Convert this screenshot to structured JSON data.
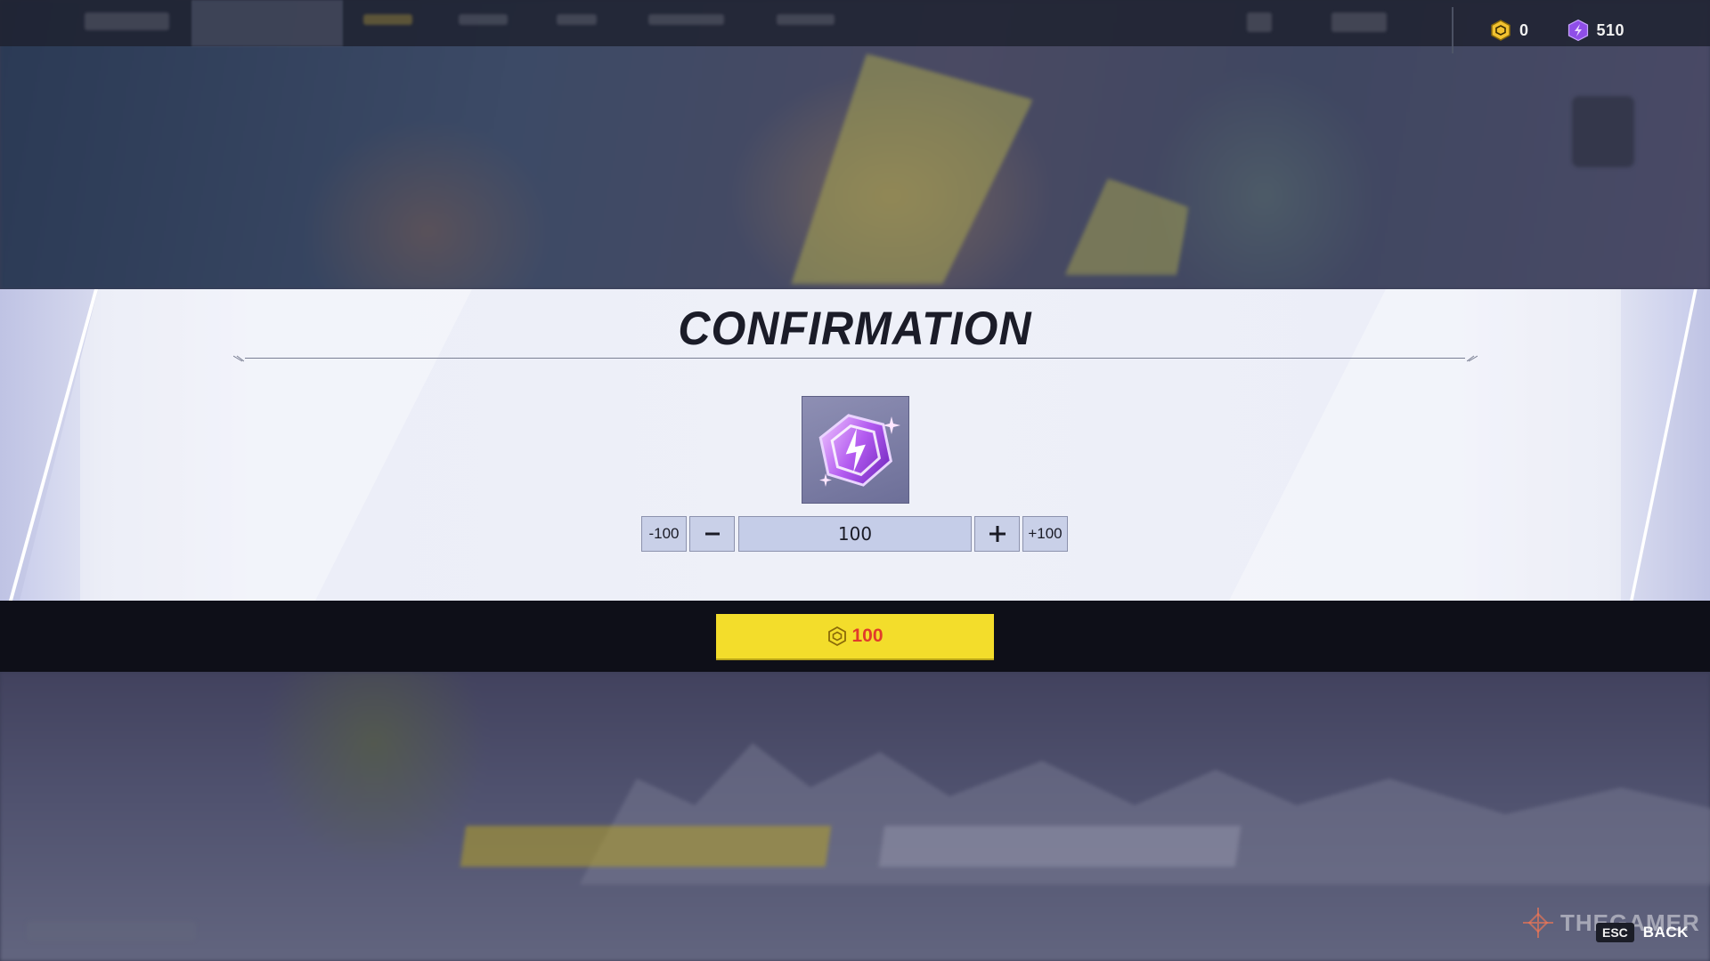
{
  "currency": {
    "gold": {
      "icon": "gold-lattice-icon",
      "amount": "0",
      "color": "#f2c230"
    },
    "units": {
      "icon": "purple-unit-icon",
      "amount": "510",
      "color": "#9b5cf0"
    }
  },
  "dialog": {
    "title": "CONFIRMATION",
    "item_icon": "units-crystal-icon",
    "quantity": "100",
    "decrement_100_label": "-100",
    "decrement_icon": "minus-icon",
    "increment_icon": "plus-icon",
    "increment_100_label": "+100"
  },
  "purchase": {
    "price": "100",
    "price_icon": "gold-lattice-icon",
    "button_color": "#f3dd2b",
    "price_color": "#e13b2b"
  },
  "footer": {
    "esc_key": "ESC",
    "back_label": "BACK",
    "watermark": "THEGAMER"
  }
}
